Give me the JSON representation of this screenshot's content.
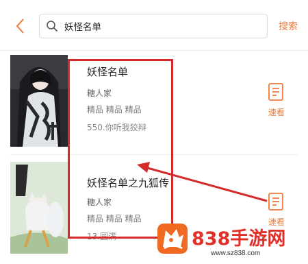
{
  "search": {
    "query": "妖怪名单",
    "button_label": "搜索"
  },
  "books": [
    {
      "title": "妖怪名单",
      "author": "糖人家",
      "tags": "精品 精品 精品",
      "latest_chapter": "550.你听我狡辩",
      "read_label": "速看"
    },
    {
      "title": "妖怪名单之九狐传",
      "author": "糖人家",
      "tags": "精品 精品 精品",
      "latest_chapter": "13.圆满",
      "read_label": "速看"
    }
  ],
  "watermark": {
    "text": "838手游网",
    "url": "www.sz838.com"
  },
  "colors": {
    "accent": "#f07a3a",
    "annotation": "#d42a2a",
    "watermark": "#e0302a"
  }
}
